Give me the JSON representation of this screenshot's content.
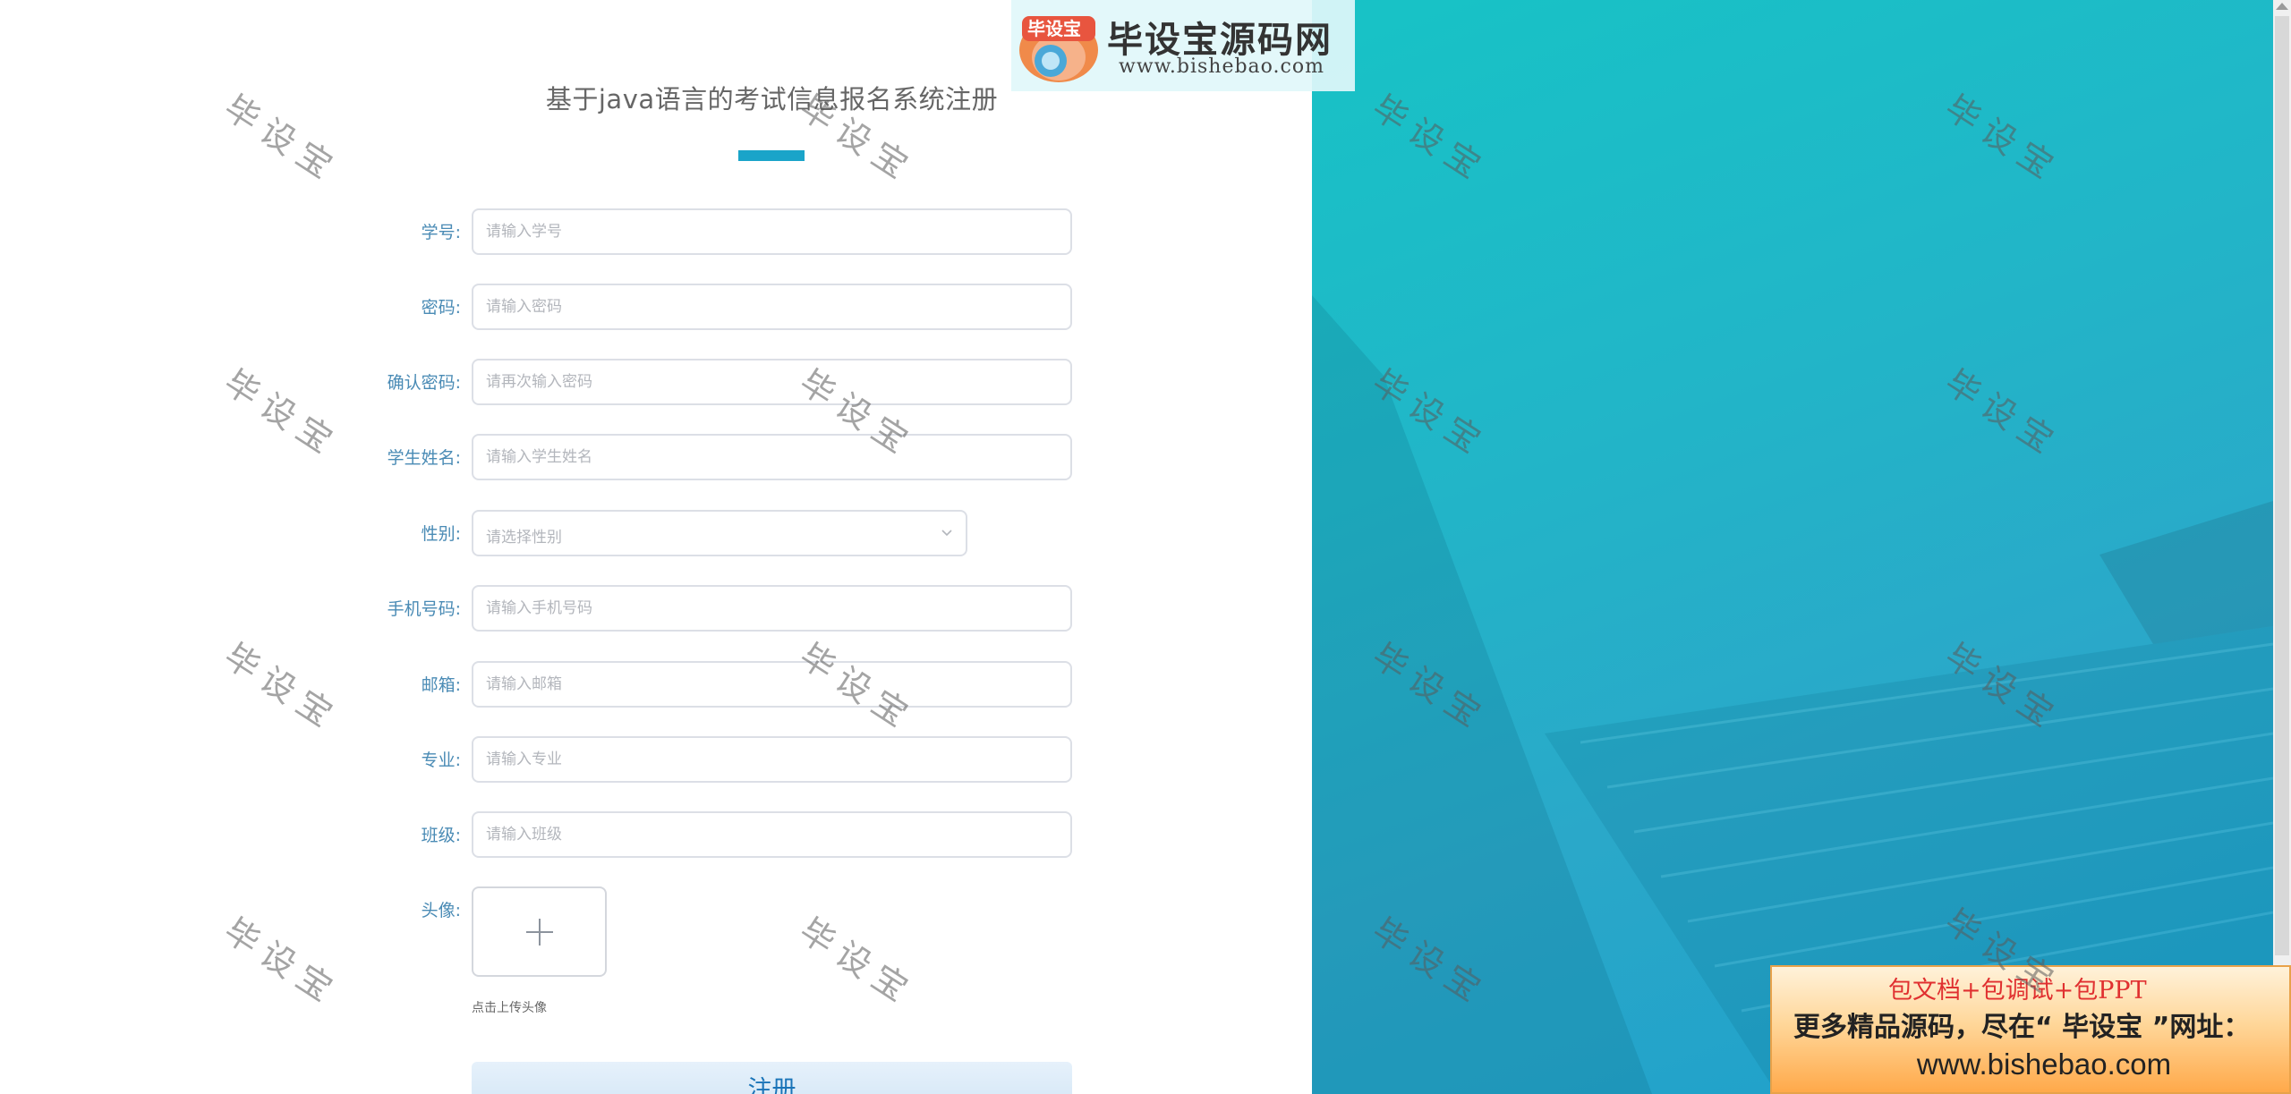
{
  "page": {
    "title": "基于java语言的考试信息报名系统注册"
  },
  "form": {
    "fields": [
      {
        "label": "学号:",
        "placeholder": "请输入学号"
      },
      {
        "label": "密码:",
        "placeholder": "请输入密码"
      },
      {
        "label": "确认密码:",
        "placeholder": "请再次输入密码"
      },
      {
        "label": "学生姓名:",
        "placeholder": "请输入学生姓名"
      },
      {
        "label": "性别:",
        "placeholder": "请选择性别"
      },
      {
        "label": "手机号码:",
        "placeholder": "请输入手机号码"
      },
      {
        "label": "邮箱:",
        "placeholder": "请输入邮箱"
      },
      {
        "label": "专业:",
        "placeholder": "请输入专业"
      },
      {
        "label": "班级:",
        "placeholder": "请输入班级"
      }
    ],
    "avatar": {
      "label": "头像:",
      "hint": "点击上传头像",
      "icon": "plus-icon"
    },
    "submit_label": "注册"
  },
  "logo": {
    "badge_text": "毕设宝",
    "title": "毕设宝源码网",
    "url": "www.bishebao.com"
  },
  "ad": {
    "line1": "包文档+包调试+包PPT",
    "line2": "更多精品源码，尽在“ 毕设宝 ”网址：",
    "line3": "www.bishebao.com"
  },
  "watermark": {
    "text": "毕设宝"
  },
  "colors": {
    "accent": "#1aa4c9",
    "label": "#4a8bb5",
    "panel_teal": "#21b6c8",
    "button_text": "#1a74b8"
  }
}
